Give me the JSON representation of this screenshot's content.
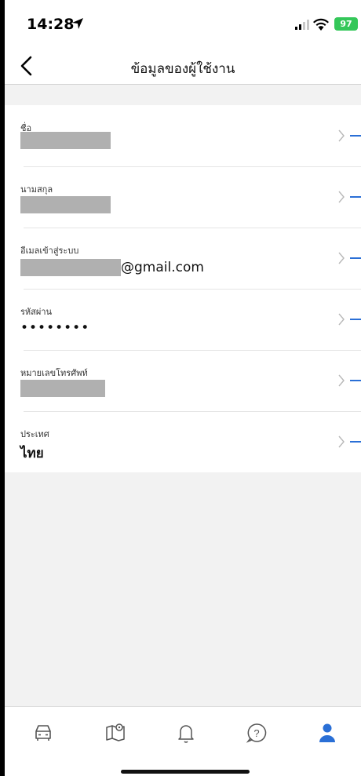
{
  "status": {
    "time": "14:28",
    "battery": "97"
  },
  "header": {
    "title": "ข้อมูลของผู้ใช้งาน"
  },
  "fields": [
    {
      "label": "ชื่อ",
      "value": ""
    },
    {
      "label": "นามสกุล",
      "value": ""
    },
    {
      "label": "อีเมลเข้าสู่ระบบ",
      "value": "@gmail.com"
    },
    {
      "label": "รหัสผ่าน",
      "value": "••••••••"
    },
    {
      "label": "หมายเลขโทรศัพท์",
      "value": ""
    },
    {
      "label": "ประเทศ",
      "value": "ไทย"
    }
  ],
  "tabbar": {
    "tabs": [
      "car-icon",
      "map-icon",
      "bell-icon",
      "help-icon",
      "profile-icon"
    ],
    "active": "profile-icon",
    "active_color": "#2a6fd6",
    "inactive_color": "#555555"
  }
}
